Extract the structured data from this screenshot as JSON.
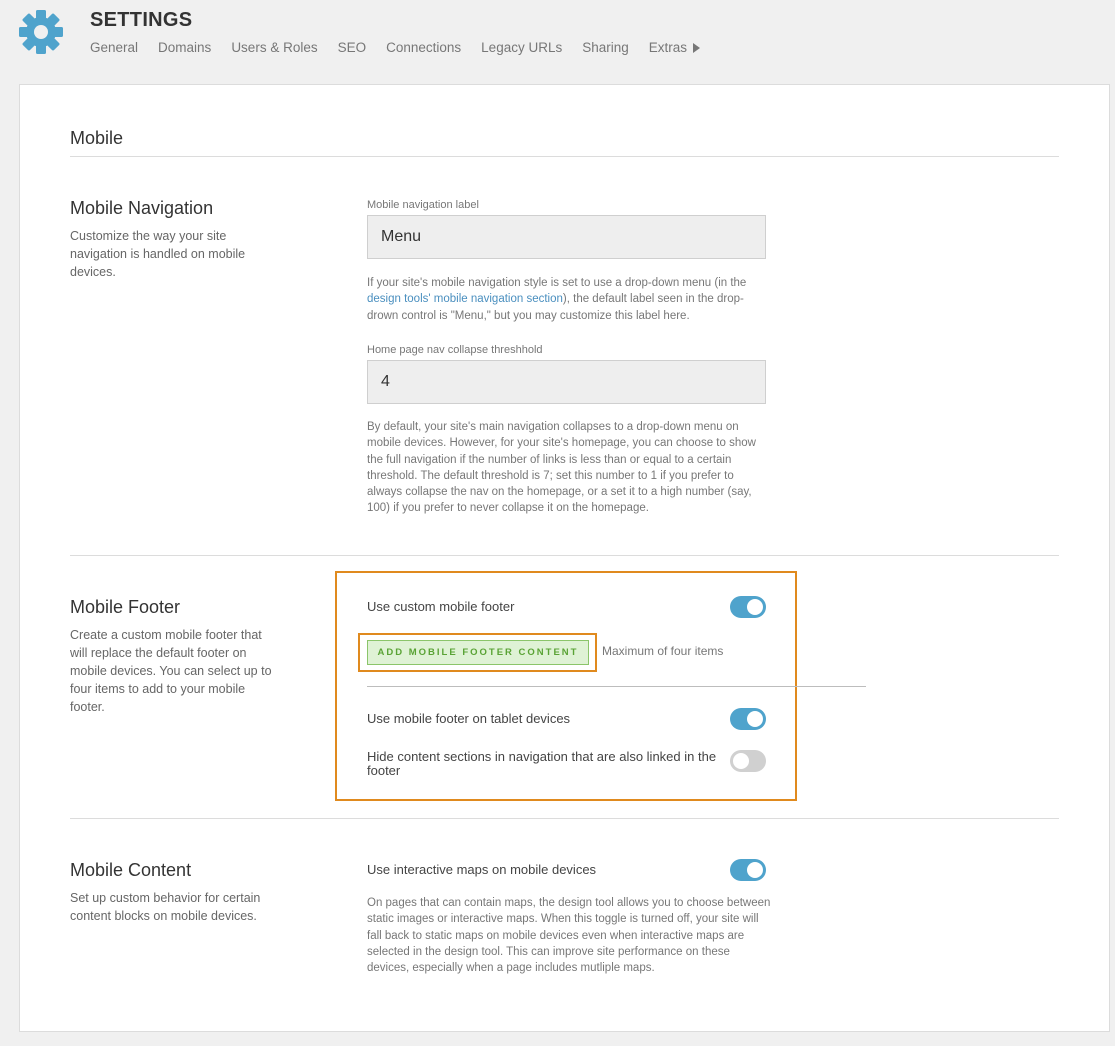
{
  "header": {
    "title": "SETTINGS",
    "tabs": [
      "General",
      "Domains",
      "Users & Roles",
      "SEO",
      "Connections",
      "Legacy URLs",
      "Sharing",
      "Extras"
    ]
  },
  "page": {
    "section_title": "Mobile"
  },
  "mobile_navigation": {
    "title": "Mobile Navigation",
    "description": "Customize the way your site navigation is handled on mobile devices.",
    "label_field": {
      "label": "Mobile navigation label",
      "value": "Menu"
    },
    "label_help": {
      "before": "If your site's mobile navigation style is set to use a drop-down menu (in the ",
      "link": "design tools' mobile navigation section",
      "after": "), the default label seen in the drop-drown control is \"Menu,\" but you may customize this label here."
    },
    "collapse_field": {
      "label": "Home page nav collapse threshhold",
      "value": "4"
    },
    "collapse_help": "By default, your site's main navigation collapses to a drop-down menu on mobile devices. However, for your site's homepage, you can choose to show the full navigation if the number of links is less than or equal to a certain threshold. The default threshold is 7; set this number to 1 if you prefer to always collapse the nav on the homepage, or a set it to a high number (say, 100) if you prefer to never collapse it on the homepage."
  },
  "mobile_footer": {
    "title": "Mobile Footer",
    "description": "Create a custom mobile footer that will replace the default footer on mobile devices. You can select up to four items to add to your mobile footer.",
    "custom_footer_label": "Use custom mobile footer",
    "custom_footer_on": true,
    "add_button_label": "ADD MOBILE FOOTER CONTENT",
    "max_note": "Maximum of four items",
    "tablet_label": "Use mobile footer on tablet devices",
    "tablet_on": true,
    "hide_sections_label": "Hide content sections in navigation that are also linked in the footer",
    "hide_sections_on": false
  },
  "mobile_content": {
    "title": "Mobile Content",
    "description": "Set up custom behavior for certain content blocks on mobile devices.",
    "maps_label": "Use interactive maps on mobile devices",
    "maps_on": true,
    "maps_help": "On pages that can contain maps, the design tool allows you to choose between static images or interactive maps. When this toggle is turned off, your site will fall back to static maps on mobile devices even when interactive maps are selected in the design tool. This can improve site performance on these devices, especially when a page includes mutliple maps."
  },
  "colors": {
    "accent": "#4fa3cc",
    "highlight": "#e08a1e",
    "button_green": "#5aa335"
  }
}
